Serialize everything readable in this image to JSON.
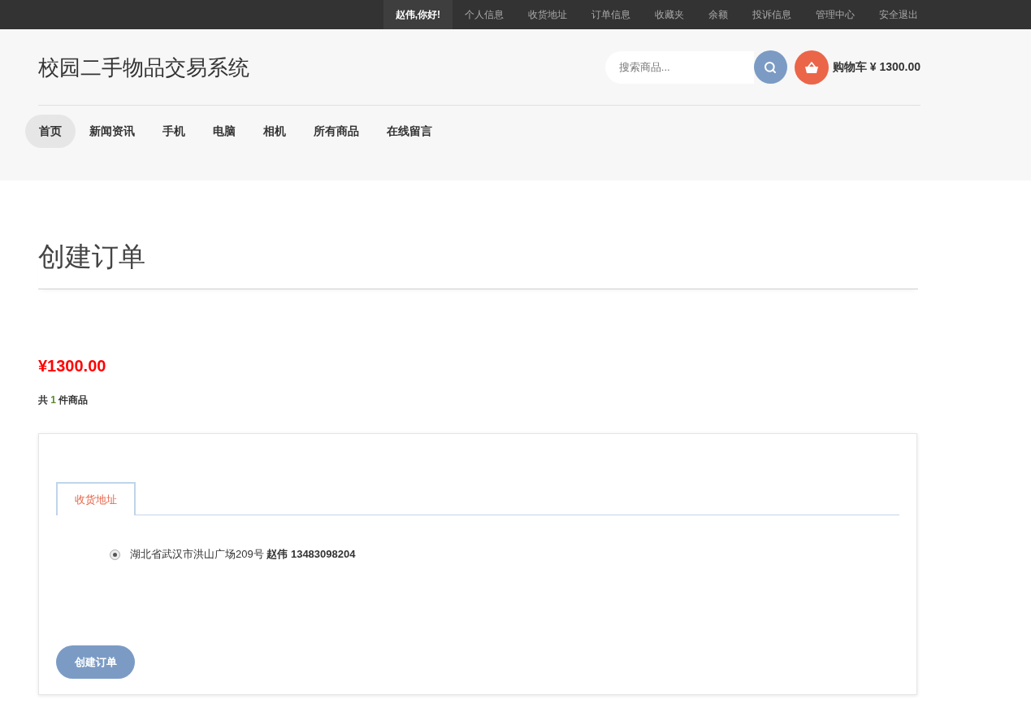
{
  "top_bar": {
    "greeting": "赵伟,你好!",
    "links": [
      "个人信息",
      "收货地址",
      "订单信息",
      "收藏夹",
      "余额",
      "投诉信息",
      "管理中心",
      "安全退出"
    ]
  },
  "header": {
    "site_title": "校园二手物品交易系统",
    "search": {
      "placeholder": "搜索商品..."
    },
    "cart": {
      "label": "购物车 ¥ 1300.00"
    }
  },
  "nav": [
    {
      "label": "首页",
      "selected": true
    },
    {
      "label": "新闻资讯",
      "selected": false
    },
    {
      "label": "手机",
      "selected": false
    },
    {
      "label": "电脑",
      "selected": false
    },
    {
      "label": "相机",
      "selected": false
    },
    {
      "label": "所有商品",
      "selected": false
    },
    {
      "label": "在线留言",
      "selected": false
    }
  ],
  "page_title": "创建订单",
  "order": {
    "total": "¥1300.00",
    "summary": {
      "prefix": "共",
      "count": "1",
      "suffix": "件商品"
    }
  },
  "form": {
    "tabs": [
      {
        "label": "收货地址",
        "selected": true
      }
    ],
    "addresses": [
      {
        "text": "湖北省武汉市洪山广场209号 **赵伟 13483098204**",
        "selected": true
      }
    ],
    "submit": "创建订单"
  }
}
